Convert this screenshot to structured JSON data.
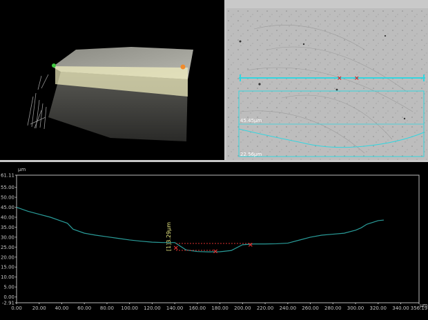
{
  "micrograph": {
    "width_label": "45.45μm",
    "bottom_label": "22.56μm"
  },
  "profile": {
    "y_unit": "μm",
    "x_unit": "μm",
    "y_ticks": [
      "61.11",
      "55.00",
      "50.00",
      "45.00",
      "40.00",
      "35.00",
      "30.00",
      "25.00",
      "20.00",
      "15.00",
      "10.00",
      "5.00",
      "0.00",
      "-2.91"
    ],
    "x_ticks": [
      "0.00",
      "20.00",
      "40.00",
      "60.00",
      "80.00",
      "100.00",
      "120.00",
      "140.00",
      "160.00",
      "180.00",
      "200.00",
      "220.00",
      "240.00",
      "260.00",
      "280.00",
      "300.00",
      "320.00",
      "340.00",
      "356.19"
    ],
    "annotation": "[1]3.29μm",
    "colors": {
      "profile_line": "#2a9d9a",
      "marker": "#e03030",
      "annotation": "#e6e680"
    }
  },
  "chart_data": {
    "type": "line",
    "xlabel": "μm",
    "ylabel": "μm",
    "xlim": [
      0,
      356.19
    ],
    "ylim": [
      -2.91,
      61.11
    ],
    "grid": false,
    "series": [
      {
        "x": [
          0,
          10,
          20,
          30,
          40,
          45,
          50,
          60,
          70,
          80,
          90,
          100,
          110,
          120,
          130,
          140,
          150,
          160,
          170,
          180,
          190,
          200,
          210,
          220,
          230,
          240,
          250,
          260,
          270,
          280,
          290,
          300,
          305,
          310,
          320,
          325
        ],
        "y": [
          45.0,
          43.0,
          41.5,
          40.0,
          38.0,
          37.0,
          34.0,
          32.0,
          31.0,
          30.2,
          29.4,
          28.6,
          28.0,
          27.5,
          27.3,
          27.3,
          23.6,
          22.8,
          22.6,
          22.7,
          23.3,
          26.2,
          26.6,
          26.6,
          26.7,
          27.0,
          28.5,
          30.0,
          31.0,
          31.5,
          32.0,
          33.5,
          34.7,
          36.5,
          38.3,
          38.6
        ]
      }
    ],
    "markers": [
      {
        "x": 141,
        "y": 24.6
      },
      {
        "x": 176,
        "y": 22.8
      },
      {
        "x": 207,
        "y": 26.2
      }
    ],
    "annotation": {
      "text": "[1]3.29μm",
      "value": 3.29
    }
  }
}
